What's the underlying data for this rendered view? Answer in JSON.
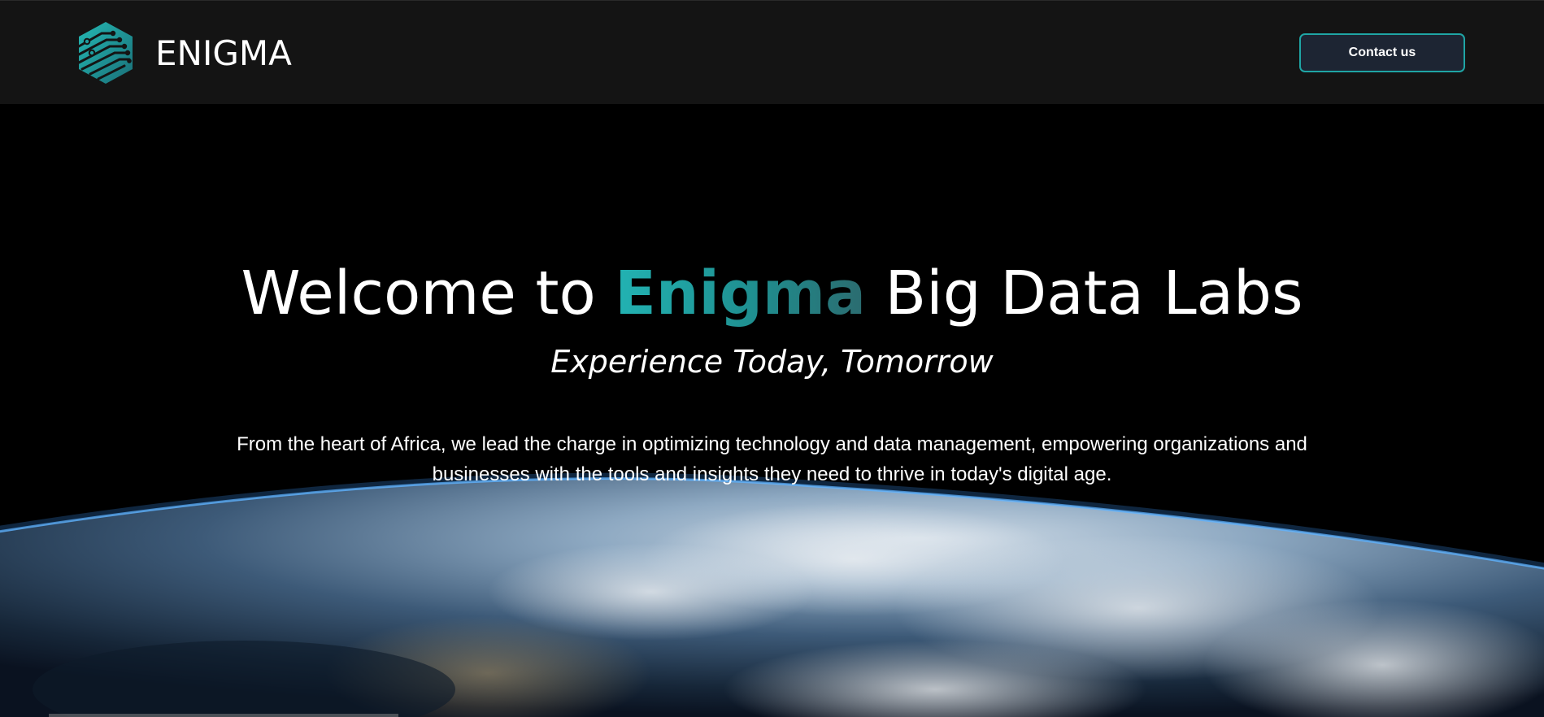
{
  "header": {
    "logo_text": "ENIGMA",
    "logo_icon": "circuit-hexagon-icon",
    "contact_label": "Contact us"
  },
  "hero": {
    "title_prefix": "Welcome to ",
    "title_brand": "Enigma",
    "title_suffix": " Big Data Labs",
    "subtitle": "Experience Today, Tomorrow",
    "description": "From the heart of Africa, we lead the charge in optimizing technology and data management, empowering organizations and businesses with the tools and insights they need to thrive in today's digital age.",
    "background_image": "earth-from-space"
  },
  "colors": {
    "accent": "#1fa5a5",
    "header_bg": "#141414",
    "button_bg": "#1d2533",
    "page_bg": "#000000"
  }
}
